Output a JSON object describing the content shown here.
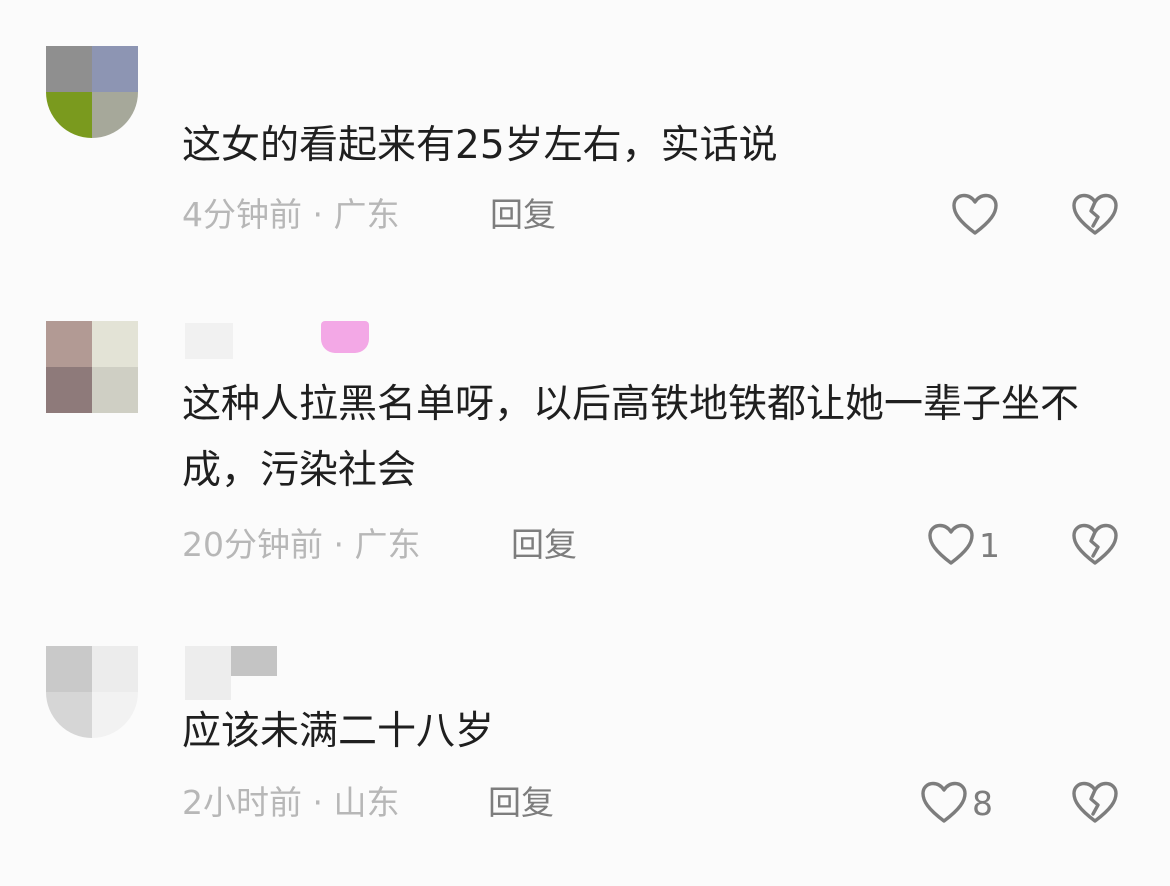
{
  "comments": [
    {
      "text": "这女的看起来有25岁左右，实话说",
      "time": "4分钟前",
      "location": "广东",
      "reply_label": "回复",
      "likes": ""
    },
    {
      "text": "这种人拉黑名单呀，以后高铁地铁都让她一辈子坐不成，污染社会",
      "time": "20分钟前",
      "location": "广东",
      "reply_label": "回复",
      "likes": "1"
    },
    {
      "text": "应该未满二十八岁",
      "time": "2小时前",
      "location": "山东",
      "reply_label": "回复",
      "likes": "8"
    }
  ],
  "meta_separator": " · ",
  "icons": {
    "like": "heart-outline-icon",
    "dislike": "broken-heart-icon"
  },
  "colors": {
    "text": "#1f1f1f",
    "meta": "#b7b7b7",
    "action": "#7d7d7d"
  }
}
